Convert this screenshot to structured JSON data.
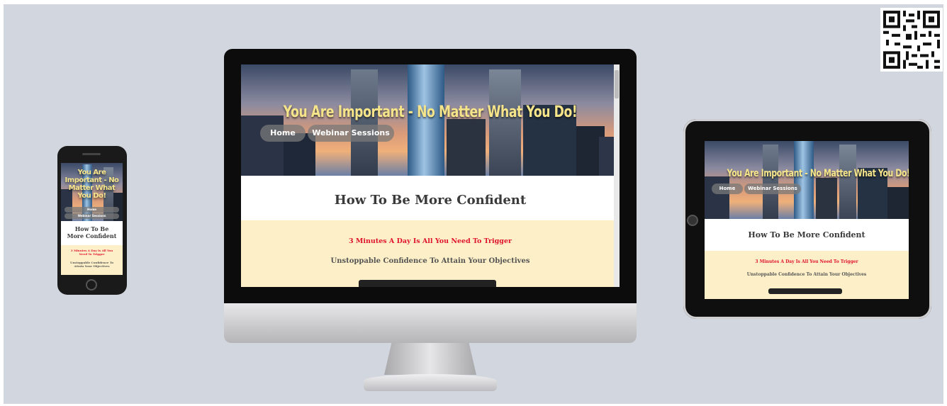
{
  "site": {
    "hero_title": "You Are Important - No Matter What You Do!",
    "phone_hero_title": "You Are Important - No Matter What You Do!",
    "nav": {
      "home_label": "Home",
      "webinar_label": "Webinar Sessions"
    },
    "headline": "How To Be More Confident",
    "red_line": "3 Minutes A Day Is All You Need To Trigger",
    "sub_line": "Unstoppable Confidence To Attain Your Objectives"
  },
  "colors": {
    "background": "#d2d6de",
    "hero_title": "#f5e48a",
    "cream_section": "#fdf0c8",
    "red_text": "#e0112b"
  },
  "icons": [
    "qr-code-icon"
  ]
}
